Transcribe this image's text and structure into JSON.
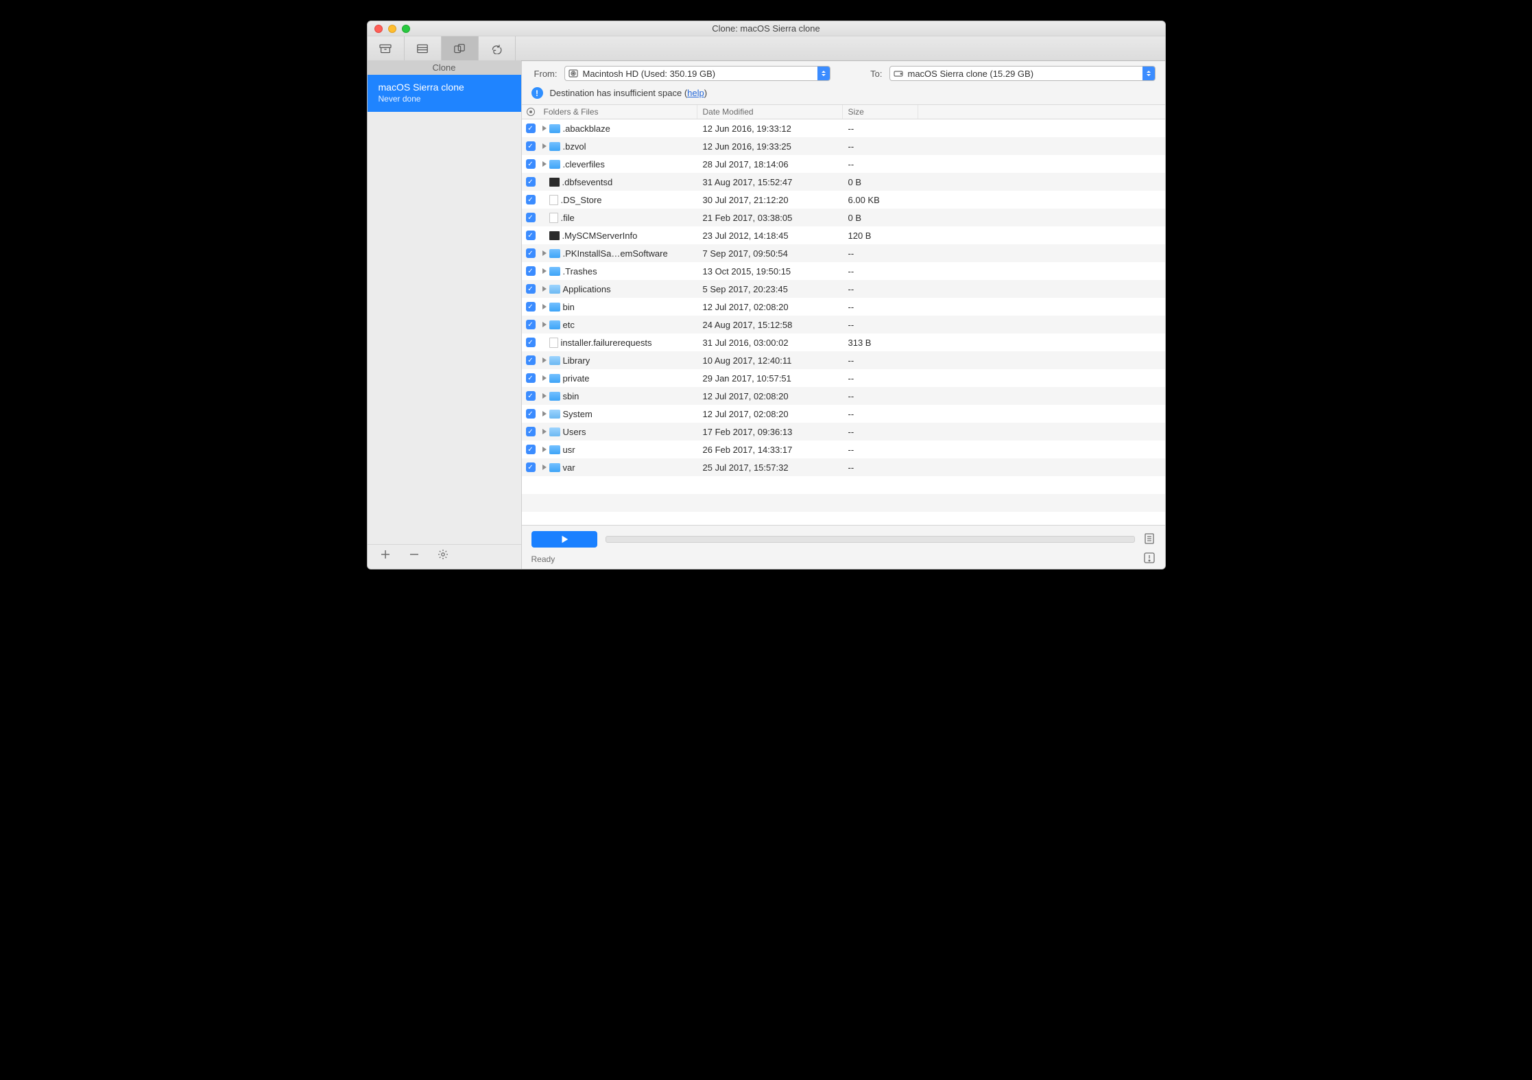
{
  "window": {
    "title": "Clone: macOS Sierra clone"
  },
  "sidebar": {
    "heading": "Clone",
    "items": [
      {
        "title": "macOS Sierra clone",
        "subtitle": "Never done"
      }
    ]
  },
  "selectors": {
    "from_label": "From:",
    "from_value": "Macintosh HD (Used: 350.19 GB)",
    "to_label": "To:",
    "to_value": "macOS Sierra clone (15.29 GB)"
  },
  "alert": {
    "text_pre": "Destination has insufficient space (",
    "link": "help",
    "text_post": ")"
  },
  "columns": {
    "name": "Folders & Files",
    "date": "Date Modified",
    "size": "Size"
  },
  "rows": [
    {
      "icon": "folder",
      "chevron": true,
      "name": ".abackblaze",
      "date": "12 Jun 2016, 19:33:12",
      "size": "--"
    },
    {
      "icon": "folder",
      "chevron": true,
      "name": ".bzvol",
      "date": "12 Jun 2016, 19:33:25",
      "size": "--"
    },
    {
      "icon": "folder",
      "chevron": true,
      "name": ".cleverfiles",
      "date": "28 Jul 2017, 18:14:06",
      "size": "--"
    },
    {
      "icon": "exec",
      "chevron": false,
      "name": ".dbfseventsd",
      "date": "31 Aug 2017, 15:52:47",
      "size": "0 B"
    },
    {
      "icon": "file",
      "chevron": false,
      "name": ".DS_Store",
      "date": "30 Jul 2017, 21:12:20",
      "size": "6.00 KB"
    },
    {
      "icon": "file",
      "chevron": false,
      "name": ".file",
      "date": "21 Feb 2017, 03:38:05",
      "size": "0 B"
    },
    {
      "icon": "exec",
      "chevron": false,
      "name": ".MySCMServerInfo",
      "date": "23 Jul 2012, 14:18:45",
      "size": "120 B"
    },
    {
      "icon": "folder",
      "chevron": true,
      "name": ".PKInstallSa…emSoftware",
      "date": "7 Sep 2017, 09:50:54",
      "size": "--"
    },
    {
      "icon": "folder",
      "chevron": true,
      "name": ".Trashes",
      "date": "13 Oct 2015, 19:50:15",
      "size": "--"
    },
    {
      "icon": "sys",
      "chevron": true,
      "name": "Applications",
      "date": "5 Sep 2017, 20:23:45",
      "size": "--"
    },
    {
      "icon": "folder",
      "chevron": true,
      "name": "bin",
      "date": "12 Jul 2017, 02:08:20",
      "size": "--"
    },
    {
      "icon": "folder",
      "chevron": true,
      "name": "etc",
      "date": "24 Aug 2017, 15:12:58",
      "size": "--"
    },
    {
      "icon": "file",
      "chevron": false,
      "name": "installer.failurerequests",
      "date": "31 Jul 2016, 03:00:02",
      "size": "313 B"
    },
    {
      "icon": "sys",
      "chevron": true,
      "name": "Library",
      "date": "10 Aug 2017, 12:40:11",
      "size": "--"
    },
    {
      "icon": "folder",
      "chevron": true,
      "name": "private",
      "date": "29 Jan 2017, 10:57:51",
      "size": "--"
    },
    {
      "icon": "folder",
      "chevron": true,
      "name": "sbin",
      "date": "12 Jul 2017, 02:08:20",
      "size": "--"
    },
    {
      "icon": "sys",
      "chevron": true,
      "name": "System",
      "date": "12 Jul 2017, 02:08:20",
      "size": "--"
    },
    {
      "icon": "sys",
      "chevron": true,
      "name": "Users",
      "date": "17 Feb 2017, 09:36:13",
      "size": "--"
    },
    {
      "icon": "folder",
      "chevron": true,
      "name": "usr",
      "date": "26 Feb 2017, 14:33:17",
      "size": "--"
    },
    {
      "icon": "folder",
      "chevron": true,
      "name": "var",
      "date": "25 Jul 2017, 15:57:32",
      "size": "--"
    }
  ],
  "status": {
    "text": "Ready"
  }
}
